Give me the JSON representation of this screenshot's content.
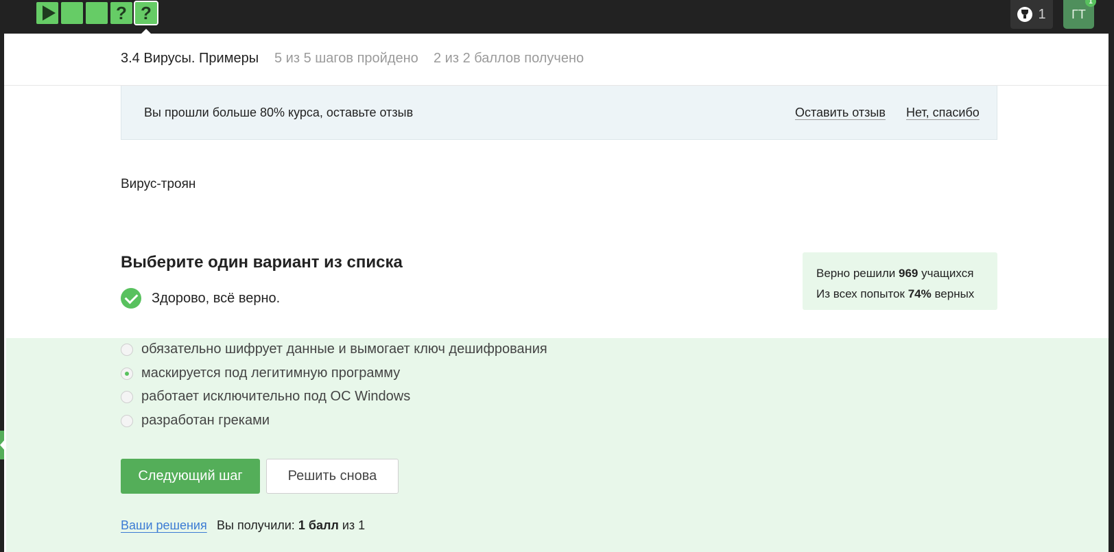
{
  "topbar": {
    "steps": [
      {
        "icon": "play-icon",
        "label": ""
      },
      {
        "icon": "",
        "label": ""
      },
      {
        "icon": "",
        "label": ""
      },
      {
        "icon": "",
        "label": "?"
      },
      {
        "icon": "",
        "label": "?"
      }
    ],
    "trophy_count": "1",
    "avatar_initials": "ГТ",
    "notification_count": "1"
  },
  "lesson": {
    "title": "3.4 Вирусы. Примеры",
    "progress": "5 из 5 шагов пройдено",
    "points": "2 из 2 баллов  получено"
  },
  "feedback": {
    "text": "Вы прошли больше 80% курса, оставьте отзыв",
    "leave_label": "Оставить отзыв",
    "decline_label": "Нет, спасибо"
  },
  "step": {
    "text": "Вирус-троян",
    "question_title": "Выберите один вариант из списка",
    "result_text": "Здорово, всё верно."
  },
  "stats": {
    "solved_prefix": "Верно решили ",
    "solved_count": "969",
    "solved_suffix": " учащихся",
    "attempts_prefix": "Из всех попыток ",
    "attempts_percent": "74%",
    "attempts_suffix": " верных"
  },
  "options": [
    {
      "label": "обязательно шифрует данные и вымогает ключ дешифрования",
      "checked": false
    },
    {
      "label": "маскируется под легитимную программу",
      "checked": true
    },
    {
      "label": "работает исключительно под ОС Windows",
      "checked": false
    },
    {
      "label": "разработан греками",
      "checked": false
    }
  ],
  "buttons": {
    "next_label": "Следующий шаг",
    "again_label": "Решить снова"
  },
  "footer": {
    "solutions_label": "Ваши решения",
    "score_prefix": "Вы получили: ",
    "score_value": "1 балл",
    "score_suffix": " из 1"
  },
  "colors": {
    "accent_green": "#54ae59",
    "success_bg": "#e8f7ea",
    "topbar_bg": "#222222",
    "link_blue": "#3b7bd4"
  }
}
